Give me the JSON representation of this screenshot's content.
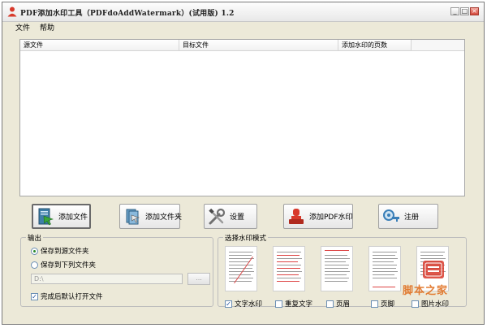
{
  "window": {
    "title": "PDF添加水印工具（PDFdoAddWatermark）(试用版) 1.2",
    "controls": [
      "_",
      "□",
      "×"
    ]
  },
  "menu": [
    "文件",
    "帮助"
  ],
  "file_list": {
    "columns": [
      "源文件",
      "目标文件",
      "添加水印的页数",
      ""
    ]
  },
  "toolbar": {
    "add_file": "添加文件",
    "add_folder": "添加文件夹",
    "settings": "设置",
    "add_watermark": "添加PDF水印",
    "register": "注册"
  },
  "output": {
    "legend": "输出",
    "save_to_source": "保存到源文件夹",
    "save_to_folder": "保存到下列文件夹",
    "path_value": "D:\\",
    "browse_label": "...",
    "open_after": "完成后默认打开文件"
  },
  "mode": {
    "legend": "选择水印模式",
    "options": [
      {
        "label": "文字水印",
        "checked": true
      },
      {
        "label": "重复文字",
        "checked": false
      },
      {
        "label": "页眉",
        "checked": false
      },
      {
        "label": "页脚",
        "checked": false
      },
      {
        "label": "图片水印",
        "checked": false
      }
    ]
  },
  "overlay_watermark": "脚本之家",
  "colors": {
    "accent_red": "#d83a2c",
    "check_blue": "#1c4f9b",
    "panel_bg": "#ece9d8",
    "watermark_orange": "#e07020"
  }
}
